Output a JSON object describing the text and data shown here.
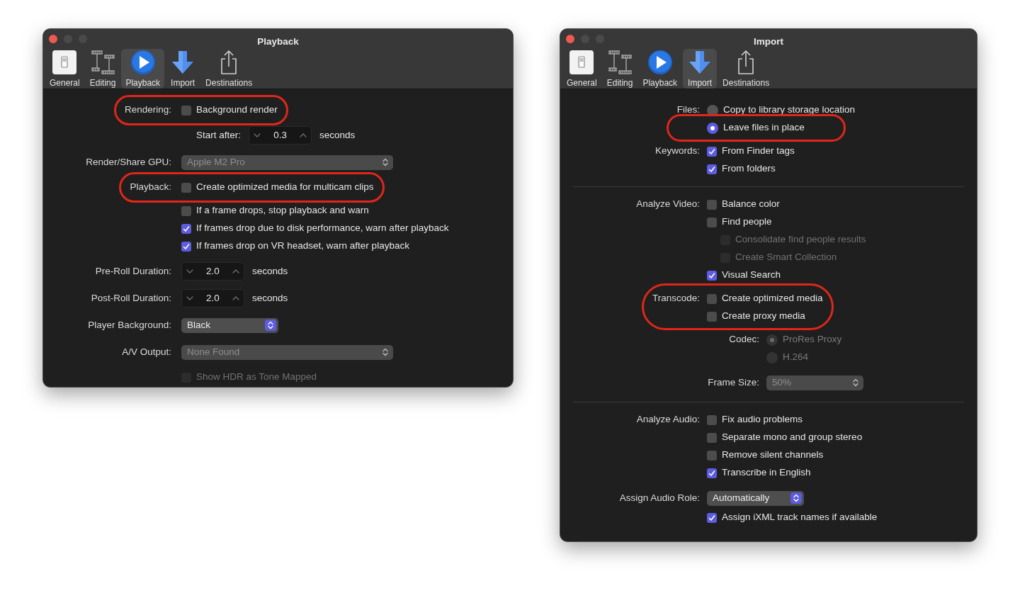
{
  "windows": [
    {
      "title": "Playback",
      "toolbar": [
        {
          "kind": "general",
          "label": "General",
          "selected": false
        },
        {
          "kind": "editing",
          "label": "Editing",
          "selected": false
        },
        {
          "kind": "playback",
          "label": "Playback",
          "selected": true
        },
        {
          "kind": "import",
          "label": "Import",
          "selected": false
        },
        {
          "kind": "destinations",
          "label": "Destinations",
          "selected": false
        }
      ],
      "sections": [
        {
          "groups": [
            {
              "kind": "group",
              "label": "Rendering:",
              "circled": true,
              "items": [
                {
                  "kind": "checkbox",
                  "label": "Background render",
                  "checked": false,
                  "disabled": false
                }
              ]
            },
            {
              "kind": "group",
              "circled": false,
              "items": [
                {
                  "kind": "stepper",
                  "caption": "Start after:",
                  "value": "0.3",
                  "unit": "seconds"
                }
              ]
            },
            {
              "kind": "group",
              "label": "Render/Share GPU:",
              "circled": false,
              "items": [
                {
                  "kind": "widepopup",
                  "value": "Apple M2 Pro",
                  "disabled": true
                }
              ]
            },
            {
              "kind": "group",
              "label": "Playback:",
              "circled": true,
              "items": [
                {
                  "kind": "checkbox",
                  "label": "Create optimized media for multicam clips",
                  "checked": false,
                  "disabled": false
                }
              ]
            },
            {
              "kind": "group",
              "circled": false,
              "items": [
                {
                  "kind": "checkbox",
                  "label": "If a frame drops, stop playback and warn",
                  "checked": false,
                  "disabled": false
                },
                {
                  "kind": "checkbox",
                  "label": "If frames drop due to disk performance, warn after playback",
                  "checked": true,
                  "disabled": false
                },
                {
                  "kind": "checkbox",
                  "label": "If frames drop on VR headset, warn after playback",
                  "checked": true,
                  "disabled": false
                }
              ]
            },
            {
              "kind": "group",
              "label": "Pre-Roll Duration:",
              "circled": false,
              "items": [
                {
                  "kind": "stepper",
                  "value": "2.0",
                  "unit": "seconds"
                }
              ]
            },
            {
              "kind": "group",
              "label": "Post-Roll Duration:",
              "circled": false,
              "items": [
                {
                  "kind": "stepper",
                  "value": "2.0",
                  "unit": "seconds"
                }
              ]
            },
            {
              "kind": "group",
              "label": "Player Background:",
              "circled": false,
              "items": [
                {
                  "kind": "popup",
                  "value": "Black",
                  "disabled": false
                }
              ]
            },
            {
              "kind": "group",
              "label": "A/V Output:",
              "circled": false,
              "items": [
                {
                  "kind": "widepopup",
                  "value": "None Found",
                  "disabled": true
                }
              ]
            },
            {
              "kind": "group",
              "circled": false,
              "items": [
                {
                  "kind": "checkbox",
                  "label": "Show HDR as Tone Mapped",
                  "checked": false,
                  "disabled": true
                }
              ]
            }
          ]
        }
      ]
    },
    {
      "title": "Import",
      "toolbar": [
        {
          "kind": "general",
          "label": "General",
          "selected": false
        },
        {
          "kind": "editing",
          "label": "Editing",
          "selected": false
        },
        {
          "kind": "playback",
          "label": "Playback",
          "selected": false
        },
        {
          "kind": "import",
          "label": "Import",
          "selected": true
        },
        {
          "kind": "destinations",
          "label": "Destinations",
          "selected": false
        }
      ],
      "sections": [
        {
          "groups": [
            {
              "kind": "group",
              "label": "Files:",
              "circled": false,
              "items": [
                {
                  "kind": "radio",
                  "label": "Copy to library storage location",
                  "selected": false,
                  "disabled": false,
                  "circled": false
                },
                {
                  "kind": "radio",
                  "label": "Leave files in place",
                  "selected": true,
                  "disabled": false,
                  "circled": true
                }
              ]
            },
            {
              "kind": "group",
              "label": "Keywords:",
              "circled": false,
              "items": [
                {
                  "kind": "checkbox",
                  "label": "From Finder tags",
                  "checked": true,
                  "disabled": false
                },
                {
                  "kind": "checkbox",
                  "label": "From folders",
                  "checked": true,
                  "disabled": false
                }
              ]
            }
          ]
        },
        {
          "groups": [
            {
              "kind": "group",
              "label": "Analyze Video:",
              "circled": false,
              "items": [
                {
                  "kind": "checkbox",
                  "label": "Balance color",
                  "checked": false,
                  "disabled": false
                },
                {
                  "kind": "checkbox",
                  "label": "Find people",
                  "checked": false,
                  "disabled": false,
                  "children": [
                    {
                      "kind": "checkbox",
                      "label": "Consolidate find people results",
                      "checked": false,
                      "disabled": true
                    },
                    {
                      "kind": "checkbox",
                      "label": "Create Smart Collection",
                      "checked": false,
                      "disabled": true
                    }
                  ]
                },
                {
                  "kind": "checkbox",
                  "label": "Visual Search",
                  "checked": true,
                  "disabled": false
                }
              ]
            },
            {
              "kind": "group",
              "label": "Transcode:",
              "circled": true,
              "items": [
                {
                  "kind": "checkbox",
                  "label": "Create optimized media",
                  "checked": false,
                  "disabled": false
                },
                {
                  "kind": "checkbox",
                  "label": "Create proxy media",
                  "checked": false,
                  "disabled": false
                }
              ]
            },
            {
              "kind": "subgroup",
              "label": "Codec:",
              "circled": false,
              "items": [
                {
                  "kind": "radio",
                  "label": "ProRes Proxy",
                  "selected": true,
                  "disabled": true
                },
                {
                  "kind": "radio",
                  "label": "H.264",
                  "selected": false,
                  "disabled": true
                }
              ]
            },
            {
              "kind": "subgroup",
              "label": "Frame Size:",
              "circled": false,
              "items": [
                {
                  "kind": "popup",
                  "value": "50%",
                  "disabled": true
                }
              ]
            }
          ]
        },
        {
          "groups": [
            {
              "kind": "group",
              "label": "Analyze Audio:",
              "circled": false,
              "items": [
                {
                  "kind": "checkbox",
                  "label": "Fix audio problems",
                  "checked": false,
                  "disabled": false
                },
                {
                  "kind": "checkbox",
                  "label": "Separate mono and group stereo",
                  "checked": false,
                  "disabled": false
                },
                {
                  "kind": "checkbox",
                  "label": "Remove silent channels",
                  "checked": false,
                  "disabled": false
                },
                {
                  "kind": "checkbox",
                  "label": "Transcribe in English",
                  "checked": true,
                  "disabled": false
                }
              ]
            },
            {
              "kind": "group",
              "label": "Assign Audio Role:",
              "circled": false,
              "items": [
                {
                  "kind": "popup",
                  "value": "Automatically",
                  "disabled": false
                },
                {
                  "kind": "checkbox",
                  "label": "Assign iXML track names if available",
                  "checked": true,
                  "disabled": false
                }
              ]
            }
          ]
        }
      ]
    }
  ]
}
